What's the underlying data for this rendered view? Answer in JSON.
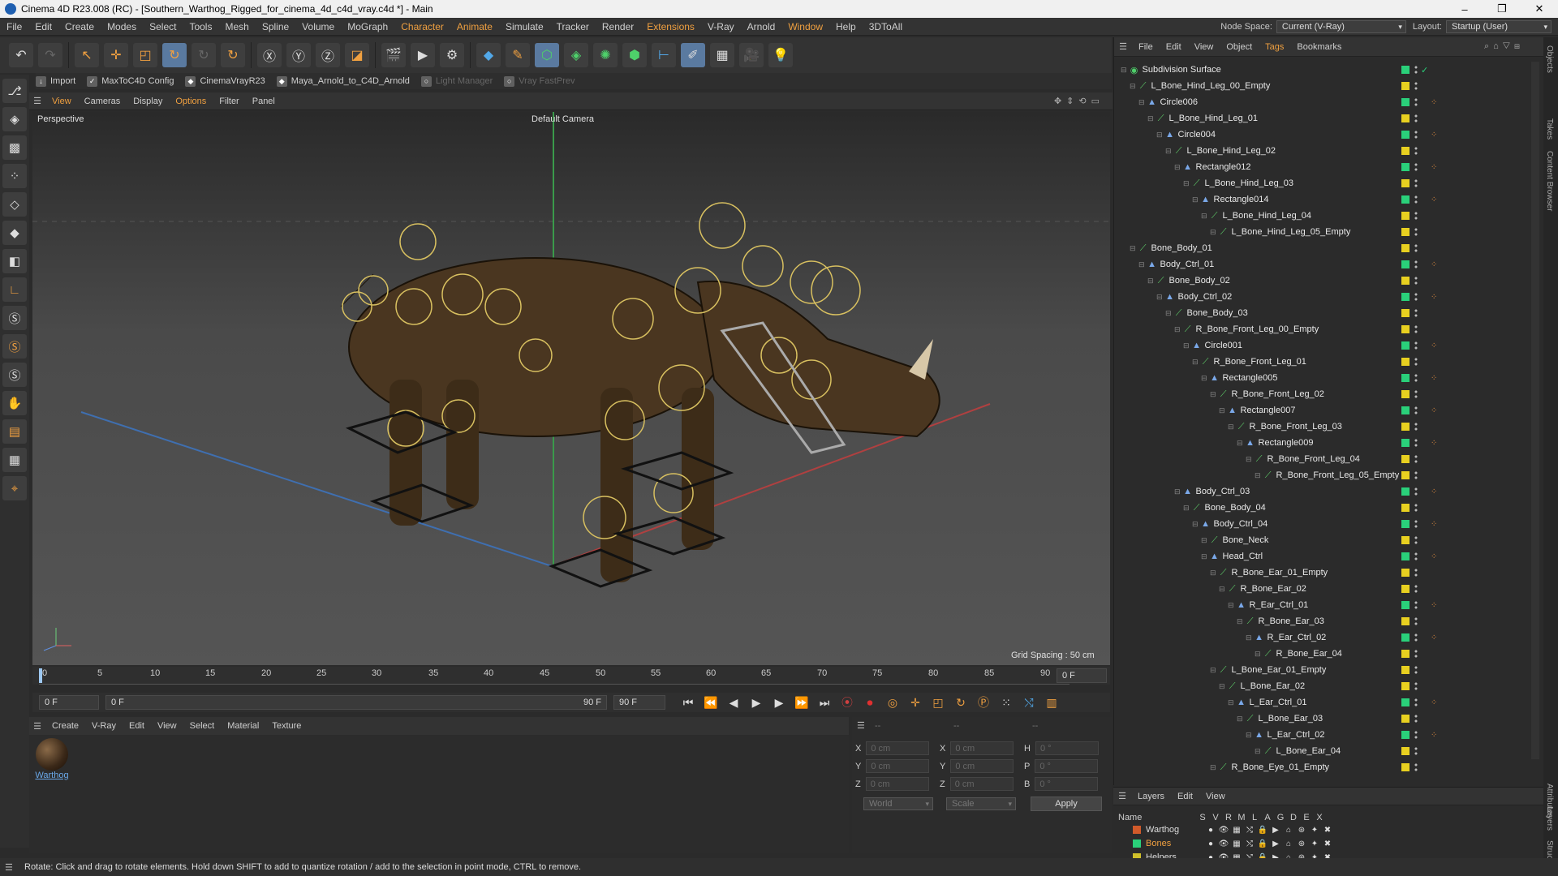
{
  "window": {
    "title": "Cinema 4D R23.008 (RC) - [Southern_Warthog_Rigged_for_cinema_4d_c4d_vray.c4d *] - Main",
    "minimize": "–",
    "maximize": "❐",
    "close": "✕"
  },
  "menu": [
    "File",
    "Edit",
    "Create",
    "Modes",
    "Select",
    "Tools",
    "Mesh",
    "Spline",
    "Volume",
    "MoGraph",
    "Character",
    "Animate",
    "Simulate",
    "Tracker",
    "Render",
    "Extensions",
    "V-Ray",
    "Arnold",
    "Window",
    "Help",
    "3DToAll"
  ],
  "node_space": {
    "label": "Node Space:",
    "value": "Current (V-Ray)"
  },
  "layout": {
    "label": "Layout:",
    "value": "Startup (User)"
  },
  "plugins": [
    {
      "label": "Import",
      "enabled": true
    },
    {
      "label": "MaxToC4D Config",
      "enabled": true
    },
    {
      "label": "CinemaVrayR23",
      "enabled": true
    },
    {
      "label": "Maya_Arnold_to_C4D_Arnold",
      "enabled": true
    },
    {
      "label": "Light Manager",
      "enabled": false
    },
    {
      "label": "Vray FastPrev",
      "enabled": false
    }
  ],
  "viewport_menu": [
    "View",
    "Cameras",
    "Display",
    "Options",
    "Filter",
    "Panel"
  ],
  "viewport": {
    "name": "Perspective",
    "camera": "Default Camera",
    "grid": "Grid Spacing : 50 cm"
  },
  "timeline": {
    "ticks": [
      "0",
      "5",
      "10",
      "15",
      "20",
      "25",
      "30",
      "35",
      "40",
      "45",
      "50",
      "55",
      "60",
      "65",
      "70",
      "75",
      "80",
      "85",
      "90"
    ],
    "current": "0 F"
  },
  "playback": {
    "start": "0 F",
    "min": "0 F",
    "max": "90 F",
    "end": "90 F"
  },
  "material_menu": [
    "Create",
    "V-Ray",
    "Edit",
    "View",
    "Select",
    "Material",
    "Texture"
  ],
  "materials": [
    {
      "name": "Warthog"
    }
  ],
  "coords": {
    "x1": "0 cm",
    "y1": "0 cm",
    "z1": "0 cm",
    "x2": "0 cm",
    "y2": "0 cm",
    "z2": "0 cm",
    "h": "0 °",
    "p": "0 °",
    "b": "0 °",
    "mode": "World",
    "scale": "Scale",
    "apply": "Apply",
    "head1": "--",
    "head2": "--",
    "head3": "--"
  },
  "status": "Rotate: Click and drag to rotate elements. Hold down SHIFT to add to quantize rotation / add to the selection in point mode, CTRL to remove.",
  "object_menu": [
    "File",
    "Edit",
    "View",
    "Object",
    "Tags",
    "Bookmarks"
  ],
  "objects": [
    {
      "name": "Subdivision Surface",
      "depth": 0,
      "type": "sub",
      "tag": false
    },
    {
      "name": "L_Bone_Hind_Leg_00_Empty",
      "depth": 1,
      "type": "bone",
      "tag": false
    },
    {
      "name": "Circle006",
      "depth": 2,
      "type": "null",
      "tag": true
    },
    {
      "name": "L_Bone_Hind_Leg_01",
      "depth": 3,
      "type": "bone",
      "tag": false
    },
    {
      "name": "Circle004",
      "depth": 4,
      "type": "null",
      "tag": true
    },
    {
      "name": "L_Bone_Hind_Leg_02",
      "depth": 5,
      "type": "bone",
      "tag": false
    },
    {
      "name": "Rectangle012",
      "depth": 6,
      "type": "null",
      "tag": true
    },
    {
      "name": "L_Bone_Hind_Leg_03",
      "depth": 7,
      "type": "bone",
      "tag": false
    },
    {
      "name": "Rectangle014",
      "depth": 8,
      "type": "null",
      "tag": true
    },
    {
      "name": "L_Bone_Hind_Leg_04",
      "depth": 9,
      "type": "bone",
      "tag": false
    },
    {
      "name": "L_Bone_Hind_Leg_05_Empty",
      "depth": 10,
      "type": "bone",
      "tag": false
    },
    {
      "name": "Bone_Body_01",
      "depth": 1,
      "type": "bone",
      "tag": false
    },
    {
      "name": "Body_Ctrl_01",
      "depth": 2,
      "type": "null",
      "tag": true
    },
    {
      "name": "Bone_Body_02",
      "depth": 3,
      "type": "bone",
      "tag": false
    },
    {
      "name": "Body_Ctrl_02",
      "depth": 4,
      "type": "null",
      "tag": true
    },
    {
      "name": "Bone_Body_03",
      "depth": 5,
      "type": "bone",
      "tag": false
    },
    {
      "name": "R_Bone_Front_Leg_00_Empty",
      "depth": 6,
      "type": "bone",
      "tag": false
    },
    {
      "name": "Circle001",
      "depth": 7,
      "type": "null",
      "tag": true
    },
    {
      "name": "R_Bone_Front_Leg_01",
      "depth": 8,
      "type": "bone",
      "tag": false
    },
    {
      "name": "Rectangle005",
      "depth": 9,
      "type": "null",
      "tag": true
    },
    {
      "name": "R_Bone_Front_Leg_02",
      "depth": 10,
      "type": "bone",
      "tag": false
    },
    {
      "name": "Rectangle007",
      "depth": 11,
      "type": "null",
      "tag": true
    },
    {
      "name": "R_Bone_Front_Leg_03",
      "depth": 12,
      "type": "bone",
      "tag": false
    },
    {
      "name": "Rectangle009",
      "depth": 13,
      "type": "null",
      "tag": true
    },
    {
      "name": "R_Bone_Front_Leg_04",
      "depth": 14,
      "type": "bone",
      "tag": false
    },
    {
      "name": "R_Bone_Front_Leg_05_Empty",
      "depth": 15,
      "type": "bone",
      "tag": false
    },
    {
      "name": "Body_Ctrl_03",
      "depth": 6,
      "type": "null",
      "tag": true
    },
    {
      "name": "Bone_Body_04",
      "depth": 7,
      "type": "bone",
      "tag": false
    },
    {
      "name": "Body_Ctrl_04",
      "depth": 8,
      "type": "null",
      "tag": true
    },
    {
      "name": "Bone_Neck",
      "depth": 9,
      "type": "bone",
      "tag": false
    },
    {
      "name": "Head_Ctrl",
      "depth": 9,
      "type": "null",
      "tag": true
    },
    {
      "name": "R_Bone_Ear_01_Empty",
      "depth": 10,
      "type": "bone",
      "tag": false
    },
    {
      "name": "R_Bone_Ear_02",
      "depth": 11,
      "type": "bone",
      "tag": false
    },
    {
      "name": "R_Ear_Ctrl_01",
      "depth": 12,
      "type": "null",
      "tag": true
    },
    {
      "name": "R_Bone_Ear_03",
      "depth": 13,
      "type": "bone",
      "tag": false
    },
    {
      "name": "R_Ear_Ctrl_02",
      "depth": 14,
      "type": "null",
      "tag": true
    },
    {
      "name": "R_Bone_Ear_04",
      "depth": 15,
      "type": "bone",
      "tag": false
    },
    {
      "name": "L_Bone_Ear_01_Empty",
      "depth": 10,
      "type": "bone",
      "tag": false
    },
    {
      "name": "L_Bone_Ear_02",
      "depth": 11,
      "type": "bone",
      "tag": false
    },
    {
      "name": "L_Ear_Ctrl_01",
      "depth": 12,
      "type": "null",
      "tag": true
    },
    {
      "name": "L_Bone_Ear_03",
      "depth": 13,
      "type": "bone",
      "tag": false
    },
    {
      "name": "L_Ear_Ctrl_02",
      "depth": 14,
      "type": "null",
      "tag": true
    },
    {
      "name": "L_Bone_Ear_04",
      "depth": 15,
      "type": "bone",
      "tag": false
    },
    {
      "name": "R_Bone_Eye_01_Empty",
      "depth": 10,
      "type": "bone",
      "tag": false
    }
  ],
  "layer_menu": [
    "Layers",
    "Edit",
    "View"
  ],
  "layer_header": {
    "name": "Name",
    "cols": [
      "S",
      "V",
      "R",
      "M",
      "L",
      "A",
      "G",
      "D",
      "E",
      "X"
    ]
  },
  "layers": [
    {
      "name": "Warthog",
      "color": "#d05a2a",
      "name_color": "#dddddd"
    },
    {
      "name": "Bones",
      "color": "#2ad07a",
      "name_color": "#f0a040"
    },
    {
      "name": "Helpers",
      "color": "#d0c02a",
      "name_color": "#dddddd"
    }
  ],
  "side_tabs": [
    "Objects",
    "Takes",
    "Content Browser",
    "Attributes",
    "Layers",
    "Structure"
  ],
  "colors": {
    "accent": "#f0a040",
    "layer_yellow": "#e8d020",
    "layer_green": "#2ad07a"
  }
}
